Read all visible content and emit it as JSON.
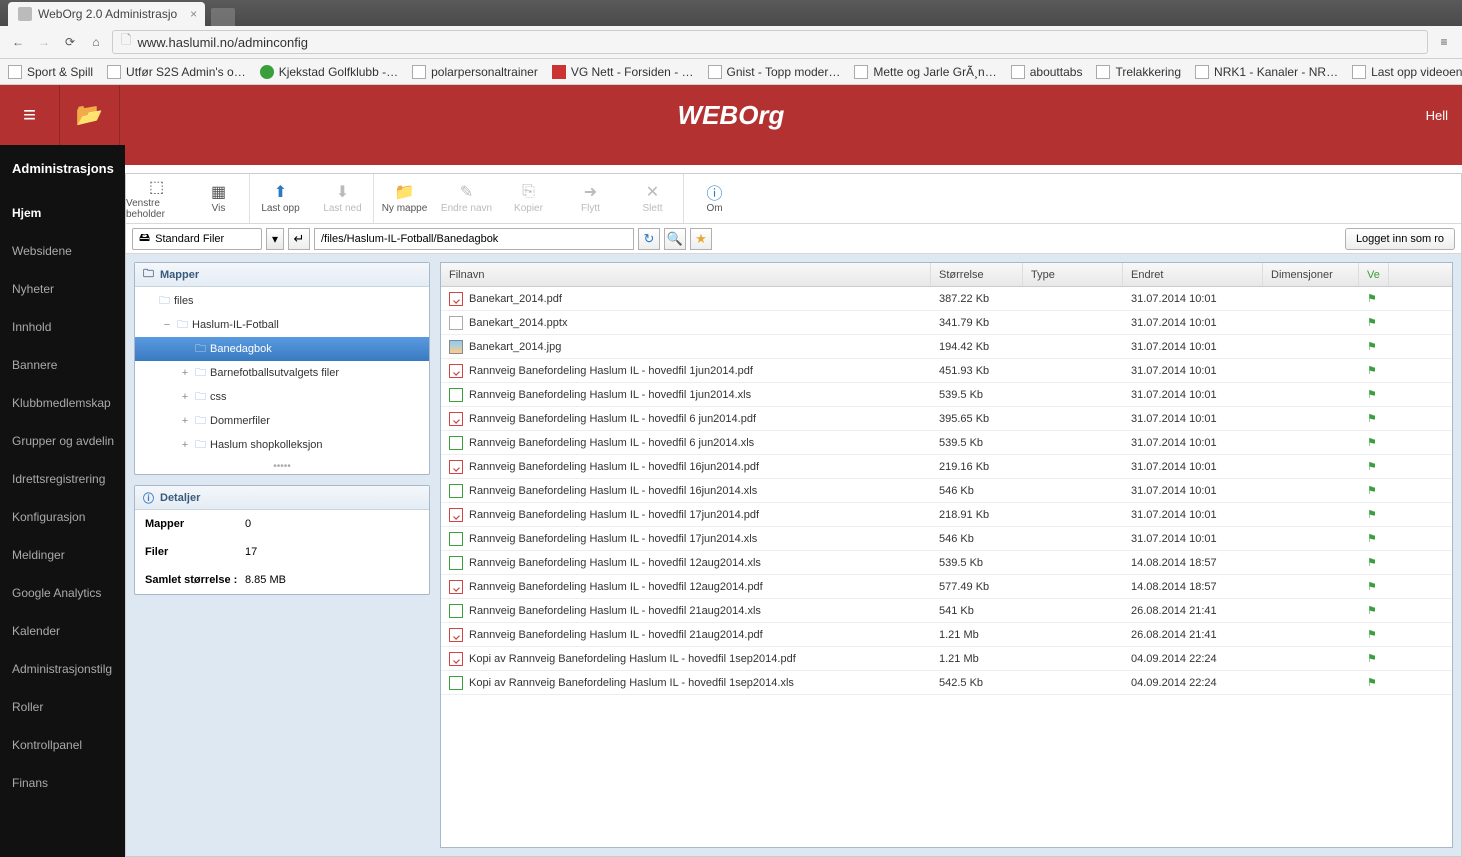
{
  "browser": {
    "tab_title": "WebOrg 2.0 Administrasjo",
    "url": "www.haslumil.no/adminconfig",
    "bookmarks": [
      {
        "label": "Sport & Spill",
        "ico": "gen"
      },
      {
        "label": "Utfør S2S Admin's o…",
        "ico": "gen"
      },
      {
        "label": "Kjekstad Golfklubb -…",
        "ico": "green"
      },
      {
        "label": "polarpersonaltrainer",
        "ico": "gen"
      },
      {
        "label": "VG Nett - Forsiden - …",
        "ico": "red"
      },
      {
        "label": "Gnist - Topp moder…",
        "ico": "gen"
      },
      {
        "label": "Mette og Jarle GrÃ¸n…",
        "ico": "gen"
      },
      {
        "label": "abouttabs",
        "ico": "gen"
      },
      {
        "label": "Trelakkering",
        "ico": "gen"
      },
      {
        "label": "NRK1 - Kanaler - NR…",
        "ico": "gen"
      },
      {
        "label": "Last opp videoen - Y…",
        "ico": "gen"
      }
    ]
  },
  "app_header": {
    "logo": "WEBOrg",
    "greeting": "Hell"
  },
  "left_nav": {
    "title": "Administrasjons",
    "items": [
      {
        "label": "Hjem",
        "active": true
      },
      {
        "label": "Websidene"
      },
      {
        "label": "Nyheter"
      },
      {
        "label": "Innhold"
      },
      {
        "label": "Bannere"
      },
      {
        "label": "Klubbmedlemskap"
      },
      {
        "label": "Grupper og avdelin"
      },
      {
        "label": "Idrettsregistrering"
      },
      {
        "label": "Konfigurasjon"
      },
      {
        "label": "Meldinger"
      },
      {
        "label": "Google Analytics"
      },
      {
        "label": "Kalender"
      },
      {
        "label": "Administrasjonstilg"
      },
      {
        "label": "Roller"
      },
      {
        "label": "Kontrollpanel"
      },
      {
        "label": "Finans"
      }
    ]
  },
  "toolbar": {
    "btns": [
      {
        "label": "Venstre beholder",
        "ic": "⬚",
        "disabled": false,
        "sep": false
      },
      {
        "label": "Vis",
        "ic": "▦",
        "disabled": false,
        "sep": true
      },
      {
        "label": "Last opp",
        "ic": "⬆",
        "disabled": false,
        "sep": false,
        "color": "#2a7ac0"
      },
      {
        "label": "Last ned",
        "ic": "⬇",
        "disabled": true,
        "sep": true
      },
      {
        "label": "Ny mappe",
        "ic": "📁",
        "disabled": false,
        "sep": false
      },
      {
        "label": "Endre navn",
        "ic": "✎",
        "disabled": true,
        "sep": false
      },
      {
        "label": "Kopier",
        "ic": "⎘",
        "disabled": true,
        "sep": false
      },
      {
        "label": "Flytt",
        "ic": "➜",
        "disabled": true,
        "sep": false
      },
      {
        "label": "Slett",
        "ic": "✕",
        "disabled": true,
        "sep": true
      },
      {
        "label": "Om",
        "ic": "ⓘ",
        "disabled": false,
        "sep": false,
        "color": "#2a7ac0"
      }
    ]
  },
  "pathbar": {
    "filer_label": "Standard Filer",
    "path": "/files/Haslum-IL-Fotball/Banedagbok",
    "login_status": "Logget inn som ro"
  },
  "tree": {
    "header": "Mapper",
    "nodes": [
      {
        "label": "files",
        "depth": 0,
        "exp": "",
        "selected": false
      },
      {
        "label": "Haslum-IL-Fotball",
        "depth": 1,
        "exp": "−",
        "selected": false
      },
      {
        "label": "Banedagbok",
        "depth": 2,
        "exp": "",
        "selected": true
      },
      {
        "label": "Barnefotballsutvalgets filer",
        "depth": 2,
        "exp": "+",
        "selected": false
      },
      {
        "label": "css",
        "depth": 2,
        "exp": "+",
        "selected": false
      },
      {
        "label": "Dommerfiler",
        "depth": 2,
        "exp": "+",
        "selected": false
      },
      {
        "label": "Haslum shopkolleksjon",
        "depth": 2,
        "exp": "+",
        "selected": false
      }
    ]
  },
  "details": {
    "header": "Detaljer",
    "rows": [
      {
        "label": "Mapper",
        "value": "0"
      },
      {
        "label": "Filer",
        "value": "17"
      },
      {
        "label": "Samlet størrelse :",
        "value": "8.85 MB"
      }
    ]
  },
  "grid": {
    "columns": {
      "name": "Filnavn",
      "size": "Størrelse",
      "type": "Type",
      "modified": "Endret",
      "dim": "Dimensjoner",
      "ver": "Ve"
    },
    "rows": [
      {
        "name": "Banekart_2014.pdf",
        "ico": "pdf",
        "size": "387.22 Kb",
        "type": "",
        "modified": "31.07.2014 10:01",
        "dim": ""
      },
      {
        "name": "Banekart_2014.pptx",
        "ico": "gen",
        "size": "341.79 Kb",
        "type": "",
        "modified": "31.07.2014 10:01",
        "dim": ""
      },
      {
        "name": "Banekart_2014.jpg",
        "ico": "img",
        "size": "194.42 Kb",
        "type": "",
        "modified": "31.07.2014 10:01",
        "dim": ""
      },
      {
        "name": "Rannveig Banefordeling Haslum IL - hovedfil 1jun2014.pdf",
        "ico": "pdf",
        "size": "451.93 Kb",
        "type": "",
        "modified": "31.07.2014 10:01",
        "dim": ""
      },
      {
        "name": "Rannveig Banefordeling Haslum IL - hovedfil 1jun2014.xls",
        "ico": "xls",
        "size": "539.5 Kb",
        "type": "",
        "modified": "31.07.2014 10:01",
        "dim": ""
      },
      {
        "name": "Rannveig Banefordeling Haslum IL - hovedfil 6 jun2014.pdf",
        "ico": "pdf",
        "size": "395.65 Kb",
        "type": "",
        "modified": "31.07.2014 10:01",
        "dim": ""
      },
      {
        "name": "Rannveig Banefordeling Haslum IL - hovedfil 6 jun2014.xls",
        "ico": "xls",
        "size": "539.5 Kb",
        "type": "",
        "modified": "31.07.2014 10:01",
        "dim": ""
      },
      {
        "name": "Rannveig Banefordeling Haslum IL - hovedfil 16jun2014.pdf",
        "ico": "pdf",
        "size": "219.16 Kb",
        "type": "",
        "modified": "31.07.2014 10:01",
        "dim": ""
      },
      {
        "name": "Rannveig Banefordeling Haslum IL - hovedfil 16jun2014.xls",
        "ico": "xls",
        "size": "546 Kb",
        "type": "",
        "modified": "31.07.2014 10:01",
        "dim": ""
      },
      {
        "name": "Rannveig Banefordeling Haslum IL - hovedfil 17jun2014.pdf",
        "ico": "pdf",
        "size": "218.91 Kb",
        "type": "",
        "modified": "31.07.2014 10:01",
        "dim": ""
      },
      {
        "name": "Rannveig Banefordeling Haslum IL - hovedfil 17jun2014.xls",
        "ico": "xls",
        "size": "546 Kb",
        "type": "",
        "modified": "31.07.2014 10:01",
        "dim": ""
      },
      {
        "name": "Rannveig Banefordeling Haslum IL - hovedfil 12aug2014.xls",
        "ico": "xls",
        "size": "539.5 Kb",
        "type": "",
        "modified": "14.08.2014 18:57",
        "dim": ""
      },
      {
        "name": "Rannveig Banefordeling Haslum IL - hovedfil 12aug2014.pdf",
        "ico": "pdf",
        "size": "577.49 Kb",
        "type": "",
        "modified": "14.08.2014 18:57",
        "dim": ""
      },
      {
        "name": "Rannveig Banefordeling Haslum IL - hovedfil 21aug2014.xls",
        "ico": "xls",
        "size": "541 Kb",
        "type": "",
        "modified": "26.08.2014 21:41",
        "dim": ""
      },
      {
        "name": "Rannveig Banefordeling Haslum IL - hovedfil 21aug2014.pdf",
        "ico": "pdf",
        "size": "1.21 Mb",
        "type": "",
        "modified": "26.08.2014 21:41",
        "dim": ""
      },
      {
        "name": "Kopi av Rannveig Banefordeling Haslum IL - hovedfil 1sep2014.pdf",
        "ico": "pdf",
        "size": "1.21 Mb",
        "type": "",
        "modified": "04.09.2014 22:24",
        "dim": ""
      },
      {
        "name": "Kopi av Rannveig Banefordeling Haslum IL - hovedfil 1sep2014.xls",
        "ico": "xls",
        "size": "542.5 Kb",
        "type": "",
        "modified": "04.09.2014 22:24",
        "dim": ""
      }
    ]
  }
}
